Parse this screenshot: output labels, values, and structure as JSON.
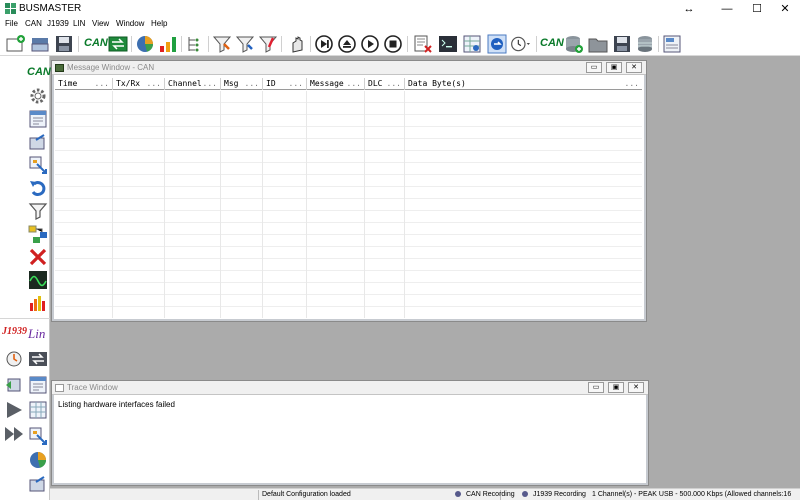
{
  "app": {
    "title": "BUSMASTER"
  },
  "window_controls": {
    "minimize": "—",
    "maximize": "☐",
    "close": "✕",
    "resize": "↔"
  },
  "menu": [
    "File",
    "CAN",
    "J1939",
    "LIN",
    "View",
    "Window",
    "Help"
  ],
  "toolbar": {
    "can_label_1": "CAN",
    "can_label_2": "CAN"
  },
  "leftbar": {
    "can_label": "CAN",
    "j1939_label": "J1939",
    "lin_label": "Lin"
  },
  "message_window": {
    "title": "Message Window - CAN",
    "columns": [
      "Time",
      "Tx/Rx",
      "Channel",
      "Msg",
      "ID",
      "Message",
      "DLC",
      "Data Byte(s)"
    ],
    "column_dots": "...",
    "buttons": {
      "minimize": "▭",
      "restore": "▣",
      "close": "✕"
    }
  },
  "trace_window": {
    "title": "Trace Window",
    "lines": [
      "Listing hardware interfaces failed"
    ],
    "buttons": {
      "minimize": "▭",
      "restore": "▣",
      "close": "✕"
    }
  },
  "status": {
    "main": "Default Configuration loaded",
    "can_recording": "CAN Recording",
    "j1939_recording": "J1939 Recording",
    "channels": "1 Channel(s) - PEAK USB - 500.000 Kbps (Allowed channels:16"
  },
  "colors": {
    "accent_green": "#0a7a2a",
    "status_dot": "#575a8c",
    "mdi_background": "#ababab"
  }
}
